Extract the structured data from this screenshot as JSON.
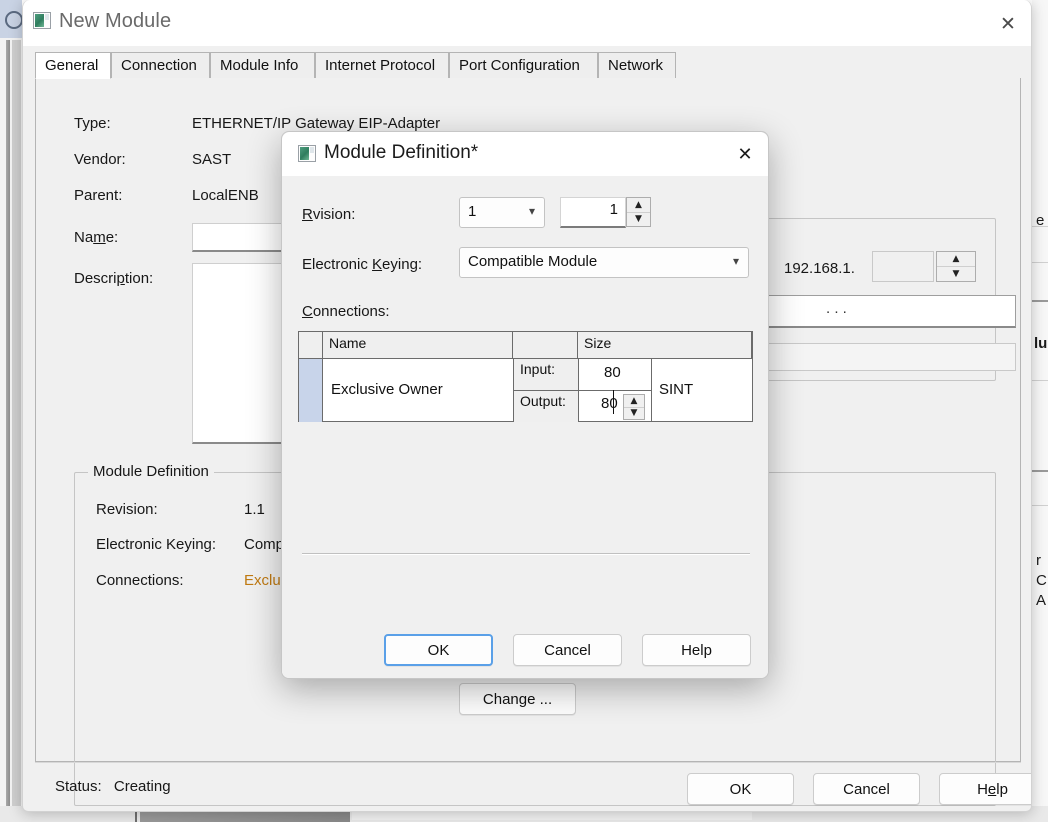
{
  "window": {
    "title": "New Module",
    "icon": "module-icon",
    "close_label": "✕"
  },
  "tabs": [
    {
      "label": "General",
      "active": true
    },
    {
      "label": "Connection",
      "active": false
    },
    {
      "label": "Module Info",
      "active": false
    },
    {
      "label": "Internet Protocol",
      "active": false
    },
    {
      "label": "Port Configuration",
      "active": false
    },
    {
      "label": "Network",
      "active": false
    }
  ],
  "general": {
    "fields": [
      {
        "label": "Type:",
        "value": "ETHERNET/IP Gateway EIP-Adapter"
      },
      {
        "label": "Vendor:",
        "value": "SAST"
      },
      {
        "label": "Parent:",
        "value": "LocalENB"
      }
    ],
    "name_label_a": "Na",
    "name_label_accel": "m",
    "name_label_b": "e:",
    "name_value": "",
    "description_label_a": "Descri",
    "description_label_accel": "p",
    "description_label_b": "tion:",
    "description_value": ""
  },
  "ethernet": {
    "ip_prefix": "192.168.1.",
    "ip_octet": "",
    "address_dots": ".      .      ."
  },
  "module_definition_group": {
    "title": "Module Definition",
    "rows": [
      {
        "label": "Revision:",
        "value": "1.1",
        "accent": false
      },
      {
        "label": "Electronic Keying:",
        "value": "Compatib",
        "accent": false
      },
      {
        "label": "Connections:",
        "value": "Exclusiv",
        "accent": true
      }
    ],
    "change_button_a": "Chan",
    "change_button_accel": "g",
    "change_button_b": "e ..."
  },
  "clipped_right": {
    "line1": "e",
    "line2": "lu",
    "line3": "r",
    "line4": "C",
    "line5": "A"
  },
  "statusbar": {
    "status_label": "Status:",
    "status_value": "Creating",
    "ok_label": "OK",
    "cancel_label": "Cancel",
    "help_a": "H",
    "help_accel": "e",
    "help_b": "lp"
  },
  "modal": {
    "title": "Module Definition*",
    "icon": "module-icon",
    "close_label": "✕",
    "revision": {
      "label_a": "R",
      "label_accel": "e",
      "label_b": "vision:",
      "major": "1",
      "minor": "1"
    },
    "electronic_keying": {
      "label_a": "Electronic ",
      "label_accel": "K",
      "label_b": "eying:",
      "value": "Compatible Module"
    },
    "connections": {
      "label_accel": "C",
      "label_b": "onnections:",
      "columns": [
        "",
        "Name",
        "",
        "Size",
        ""
      ],
      "header_name": "Name",
      "header_size": "Size",
      "row": {
        "name": "Exclusive Owner",
        "input_label": "Input:",
        "input_size": "80",
        "output_label": "Output:",
        "output_size": "80",
        "datatype": "SINT",
        "selected": true,
        "editing_field": "output_size"
      }
    },
    "buttons": {
      "ok": "OK",
      "cancel": "Cancel",
      "help": "Help",
      "default": "ok"
    }
  },
  "colors": {
    "accent": "#c07a12",
    "focus_ring": "#5aa0e8",
    "selection": "#c8d4ea",
    "window_bg": "#f0f0f0",
    "titlebar_bg": "#ffffff"
  }
}
